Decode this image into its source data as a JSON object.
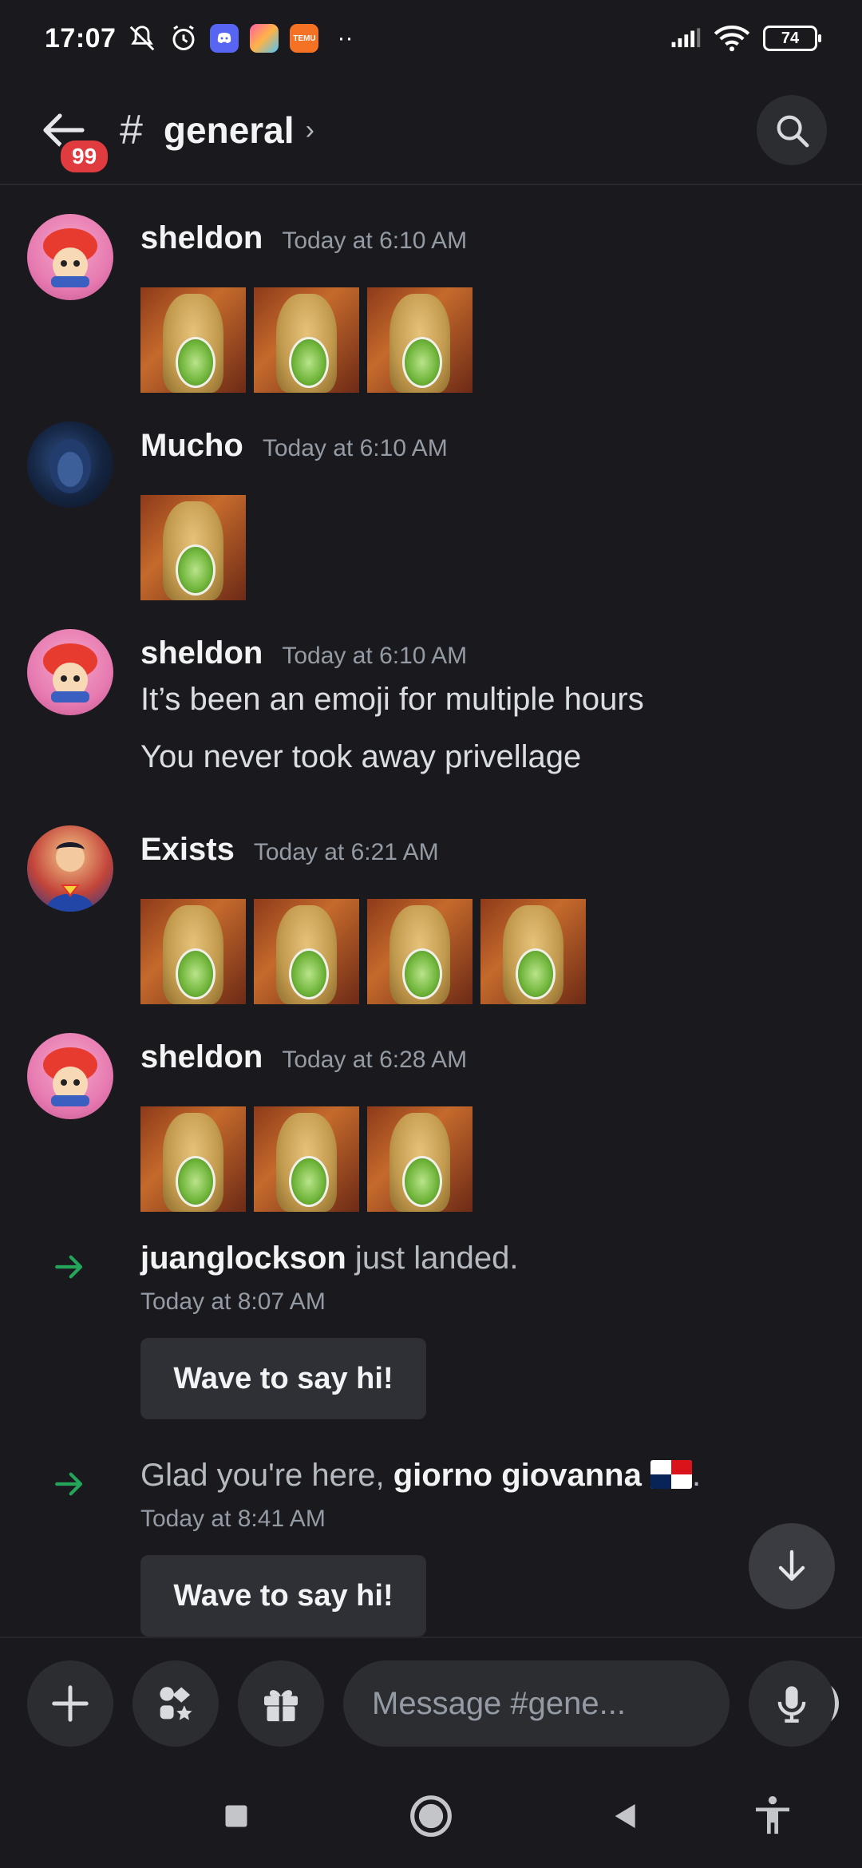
{
  "status_bar": {
    "time": "17:07",
    "battery": "74",
    "icons": [
      "mute-icon",
      "alarm-icon",
      "discord-icon",
      "photos-app-icon",
      "temu-icon",
      "more-dots-icon",
      "signal-icon",
      "wifi-icon"
    ]
  },
  "header": {
    "unread_badge": "99",
    "hash": "#",
    "channel_name": "general",
    "chevron": "›"
  },
  "messages": [
    {
      "username": "sheldon",
      "timestamp": "Today at 6:10 AM",
      "emoji_count": 3
    },
    {
      "username": "Mucho",
      "timestamp": "Today at 6:10 AM",
      "emoji_count": 1
    },
    {
      "username": "sheldon",
      "timestamp": "Today at 6:10 AM",
      "lines": [
        "It’s been an emoji for multiple hours",
        "You never took away privellage"
      ]
    },
    {
      "username": "Exists",
      "timestamp": "Today at 6:21 AM",
      "emoji_count": 4
    },
    {
      "username": "sheldon",
      "timestamp": "Today at 6:28 AM",
      "emoji_count": 3
    }
  ],
  "joins": [
    {
      "name": "juanglockson",
      "suffix": " just landed.",
      "time": "Today at 8:07 AM",
      "button": "Wave to say hi!"
    },
    {
      "prefix": "Glad you're here, ",
      "name": "giorno giovanna",
      "suffix": ".",
      "time": "Today at 8:41 AM",
      "button": "Wave to say hi!"
    }
  ],
  "composer": {
    "placeholder": "Message #gene..."
  },
  "colors": {
    "background": "#1a1a1e",
    "badge": "#e03b3f",
    "join_arrow": "#23a55a",
    "button_bg": "#2e3035"
  }
}
